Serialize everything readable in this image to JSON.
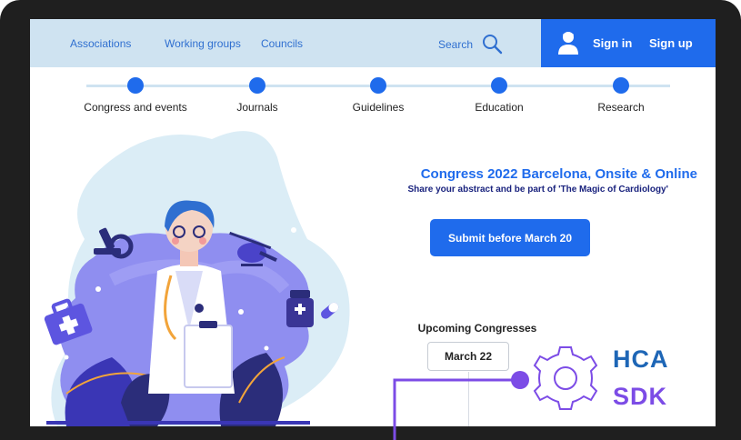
{
  "header": {
    "nav": [
      "Associations",
      "Working groups",
      "Councils"
    ],
    "search_label": "Search",
    "sign_in": "Sign in",
    "sign_up": "Sign up"
  },
  "timeline": {
    "items": [
      "Congress and events",
      "Journals",
      "Guidelines",
      "Education",
      "Research"
    ]
  },
  "hero": {
    "title": "Congress 2022 Barcelona, Onsite & Online",
    "subtitle": "Share your abstract and be part of 'The Magic of Cardiology'",
    "cta": "Submit before March 20"
  },
  "upcoming": {
    "title": "Upcoming Congresses",
    "date": "March 22"
  },
  "watermark": {
    "line1": "HCA",
    "line2": "SDK"
  },
  "colors": {
    "primary": "#1f6bec",
    "header_bg": "#cfe3f1",
    "navy": "#1a237e",
    "purple": "#7c4ce6",
    "frame": "#1f1f1f"
  }
}
